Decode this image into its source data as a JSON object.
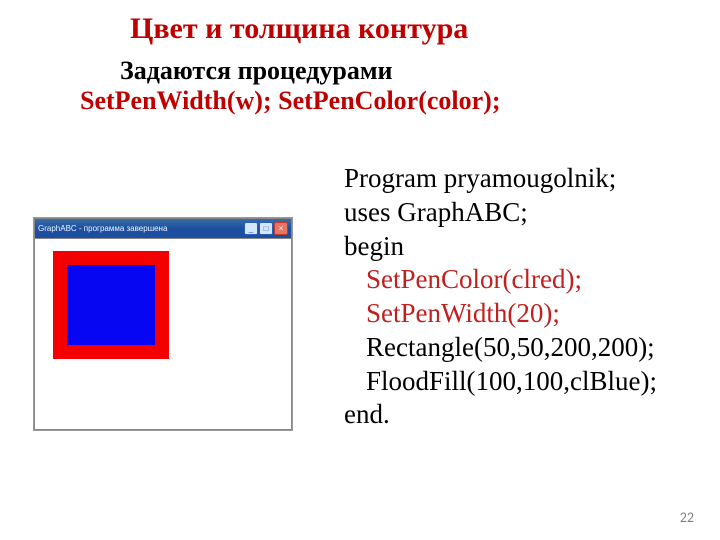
{
  "title": "Цвет и толщина контура",
  "subtitle_line1": "Задаются процедурами",
  "subtitle_line2": "SetPenWidth(w); SetPenColor(color);",
  "window_title": "GraphABC - программа завершена",
  "code": {
    "l1": "Program pryamougolnik;",
    "l2": "uses GraphABC;",
    "l3": "begin",
    "l4": "SetPenColor(clred);",
    "l5": "SetPenWidth(20);",
    "l6": "Rectangle(50,50,200,200);",
    "l7": "FloodFill(100,100,clBlue);",
    "l8": "end."
  },
  "page_number": "22"
}
